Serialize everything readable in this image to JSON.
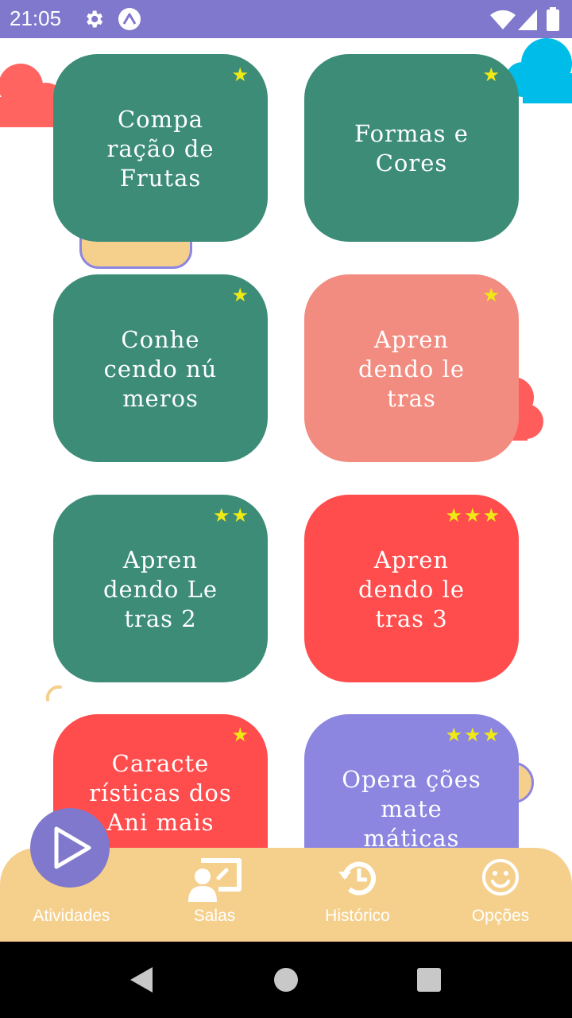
{
  "status_bar": {
    "time": "21:05",
    "settings_icon": "gear-icon",
    "app_icon": "expo-icon"
  },
  "activities": [
    {
      "title": "Compa ração de Frutas",
      "stars": 1,
      "color": "#3c8c78"
    },
    {
      "title": "Formas e Cores",
      "stars": 1,
      "color": "#3c8c78"
    },
    {
      "title": "Conhe cendo nú meros",
      "stars": 1,
      "color": "#3c8c78"
    },
    {
      "title": "Apren dendo le tras",
      "stars": 1,
      "color": "#f28c80"
    },
    {
      "title": "Apren dendo Le tras 2",
      "stars": 2,
      "color": "#3c8c78"
    },
    {
      "title": "Apren dendo le tras 3",
      "stars": 3,
      "color": "#ff4c4c"
    },
    {
      "title": "Caracte rísticas dos Ani mais",
      "stars": 1,
      "color": "#ff4c4c"
    },
    {
      "title": "Opera ções mate máticas",
      "stars": 3,
      "color": "#8c86e0"
    }
  ],
  "bottom_nav": {
    "items": [
      {
        "label": "Atividades",
        "icon": "play-icon"
      },
      {
        "label": "Salas",
        "icon": "classroom-icon"
      },
      {
        "label": "Histórico",
        "icon": "history-icon"
      },
      {
        "label": "Opções",
        "icon": "smiley-icon"
      }
    ]
  },
  "colors": {
    "status_bar": "#8078cc",
    "bottom_bar": "#f5d08d",
    "star": "#f0ea14"
  }
}
